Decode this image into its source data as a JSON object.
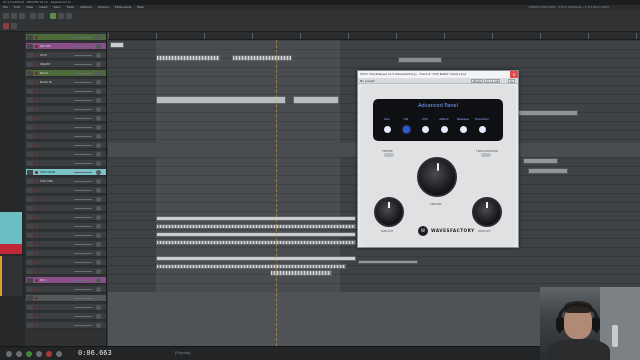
{
  "window": {
    "title": "Ori [modified] - REAPER v6.xx - Registered to ...",
    "top_right": "[48kHz 24bit WAV : 1/1ch 1024spls ~1.7/1.8ms ASIO]"
  },
  "menu": [
    "File",
    "Edit",
    "View",
    "Insert",
    "Item",
    "Track",
    "Options",
    "Actions",
    "Extensions",
    "Help"
  ],
  "tracks": [
    {
      "name": "",
      "style": "folder"
    },
    {
      "name": "DRUMS",
      "style": "pink"
    },
    {
      "name": "KICK",
      "style": "normal"
    },
    {
      "name": "SNARE",
      "style": "normal"
    },
    {
      "name": "BASS",
      "style": "folder"
    },
    {
      "name": "BASS DI",
      "style": "normal"
    },
    {
      "name": "",
      "style": "normal"
    },
    {
      "name": "",
      "style": "normal"
    },
    {
      "name": "",
      "style": "normal"
    },
    {
      "name": "",
      "style": "normal"
    },
    {
      "name": "",
      "style": "normal"
    },
    {
      "name": "",
      "style": "normal"
    },
    {
      "name": "",
      "style": "normal"
    },
    {
      "name": "",
      "style": "normal"
    },
    {
      "name": "",
      "style": "normal"
    },
    {
      "name": "VOX MAIN",
      "style": "sel"
    },
    {
      "name": "VOX DBL",
      "style": "normal"
    },
    {
      "name": "",
      "style": "normal"
    },
    {
      "name": "",
      "style": "normal"
    },
    {
      "name": "",
      "style": "normal"
    },
    {
      "name": "",
      "style": "normal"
    },
    {
      "name": "",
      "style": "normal"
    },
    {
      "name": "",
      "style": "normal"
    },
    {
      "name": "",
      "style": "normal"
    },
    {
      "name": "",
      "style": "normal"
    },
    {
      "name": "",
      "style": "normal"
    },
    {
      "name": "",
      "style": "normal"
    },
    {
      "name": "BUS",
      "style": "pink"
    },
    {
      "name": "",
      "style": "normal"
    },
    {
      "name": "",
      "style": "gray"
    },
    {
      "name": "",
      "style": "normal"
    },
    {
      "name": "",
      "style": "normal"
    },
    {
      "name": "",
      "style": "normal"
    }
  ],
  "transport": {
    "time": "0:06.663",
    "status": "[Playing]"
  },
  "plugin": {
    "title": "VST3: Tracktspear (2-5 Wavesfactory) - Track 8 \"VOX MAIN\" (Slot) [1/1]",
    "preset_label": "No preset",
    "buttons": [
      "Param",
      "2 in 2 out",
      "UI"
    ],
    "panel_title": "Advanced Panel",
    "panel_cols": [
      "Pan",
      "L/R",
      "M/S",
      "Attack",
      "Release",
      "Transition"
    ],
    "panel_dots": [
      "on",
      "sel",
      "on",
      "on",
      "on",
      "on"
    ],
    "left_label": "FREEZE",
    "right_label": "TRACKSPEAKER",
    "big_knob_label": "AMOUNT",
    "low_cut_label": "LOW CUT",
    "high_cut_label": "HIGH CUT",
    "brand": "WAVESFACTORY",
    "logo_letter": "W"
  }
}
